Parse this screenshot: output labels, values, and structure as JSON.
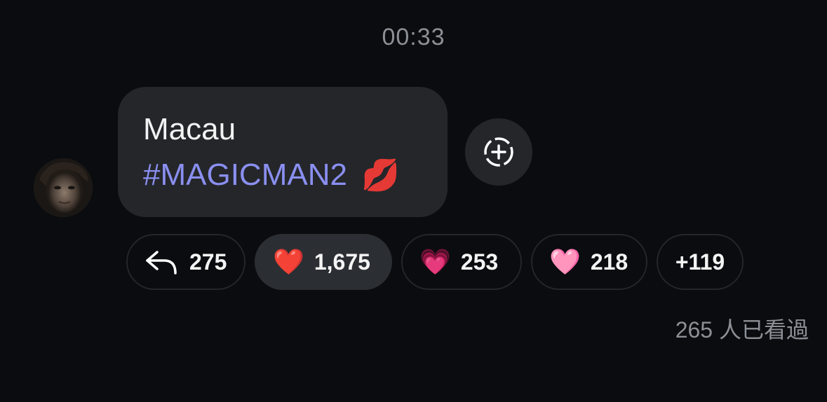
{
  "timestamp": "00:33",
  "message": {
    "text_line1": "Macau",
    "hashtag": "#MAGICMAN2",
    "emoji": "💋"
  },
  "reactions": [
    {
      "icon": "reply-arrow-icon",
      "count": "275"
    },
    {
      "icon": "red-heart",
      "emoji": "❤️",
      "count": "1,675"
    },
    {
      "icon": "sparkling-heart",
      "emoji": "💗",
      "count": "253"
    },
    {
      "icon": "pink-heart",
      "emoji": "🩷",
      "count": "218"
    },
    {
      "more": "+119"
    }
  ],
  "views": "265 人已看過",
  "colors": {
    "background": "#0a0c0f",
    "bubble": "#24262a",
    "hashtag": "#8a8ff0",
    "muted": "#8c9096"
  }
}
